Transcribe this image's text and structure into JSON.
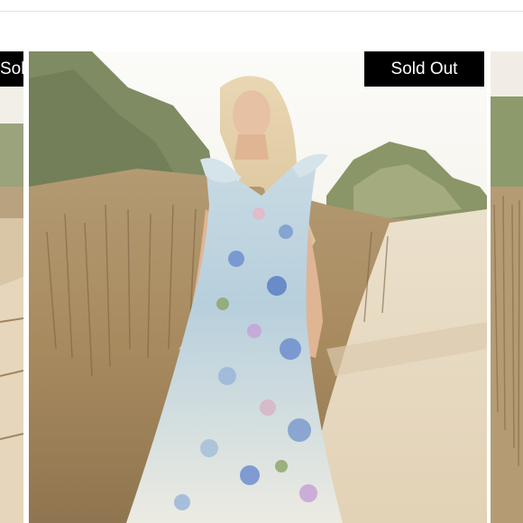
{
  "product": {
    "badge_text": "Sold Out"
  },
  "carousel": {
    "prev_badge_text": "Sold Out"
  }
}
